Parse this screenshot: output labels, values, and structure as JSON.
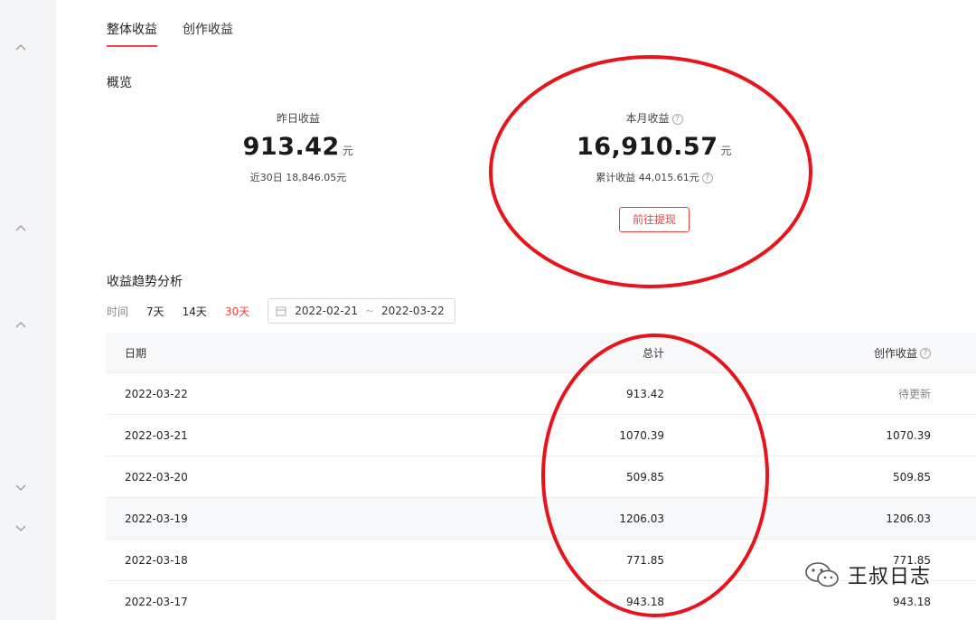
{
  "tabs": [
    {
      "label": "整体收益",
      "active": true
    },
    {
      "label": "创作收益",
      "active": false
    }
  ],
  "overview": {
    "title": "概览",
    "yesterday": {
      "label": "昨日收益",
      "value": "913.42",
      "unit": "元",
      "sub": "近30日 18,846.05元"
    },
    "month": {
      "label": "本月收益",
      "value": "16,910.57",
      "unit": "元",
      "sub": "累计收益 44,015.61元",
      "help_icon": "question-icon"
    },
    "withdraw_label": "前往提现"
  },
  "trend": {
    "title": "收益趋势分析",
    "filter_label": "时间",
    "ranges": [
      "7天",
      "14天",
      "30天"
    ],
    "active_range": "30天",
    "date_start": "2022-02-21",
    "date_sep": "~",
    "date_end": "2022-03-22"
  },
  "table": {
    "headers": {
      "date": "日期",
      "total": "总计",
      "create": "创作收益"
    },
    "rows": [
      {
        "date": "2022-03-22",
        "total": "913.42",
        "create": "待更新"
      },
      {
        "date": "2022-03-21",
        "total": "1070.39",
        "create": "1070.39"
      },
      {
        "date": "2022-03-20",
        "total": "509.85",
        "create": "509.85"
      },
      {
        "date": "2022-03-19",
        "total": "1206.03",
        "create": "1206.03"
      },
      {
        "date": "2022-03-18",
        "total": "771.85",
        "create": "771.85"
      },
      {
        "date": "2022-03-17",
        "total": "943.18",
        "create": "943.18"
      }
    ]
  },
  "watermark": {
    "text": "王叔日志",
    "icon": "wechat-icon"
  },
  "colors": {
    "accent": "#f04142",
    "annotation": "#e8141b"
  }
}
